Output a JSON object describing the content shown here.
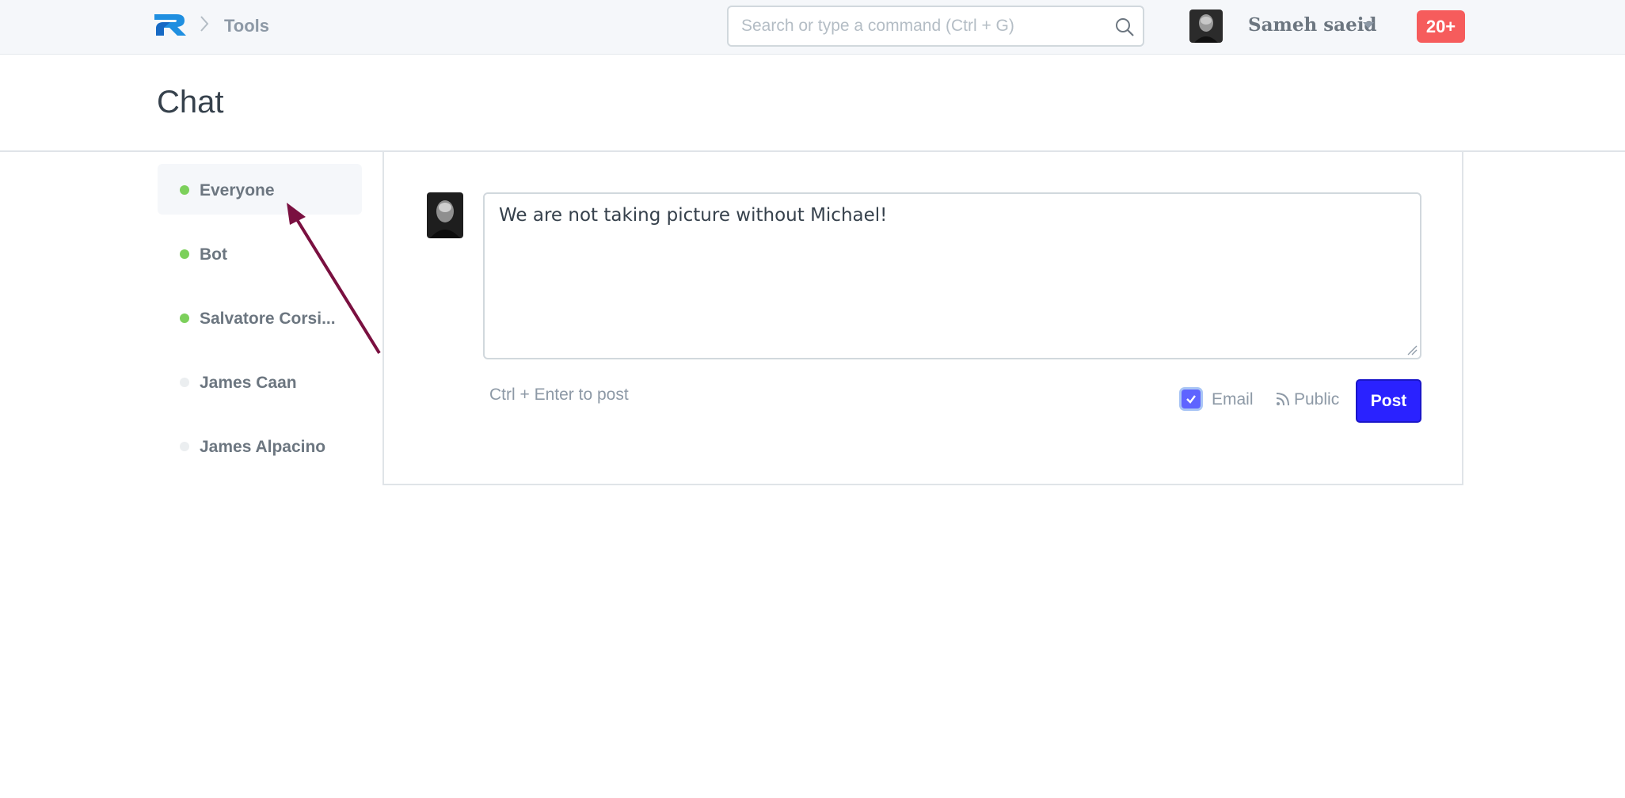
{
  "navbar": {
    "breadcrumb": "Tools",
    "search_placeholder": "Search or type a command (Ctrl + G)",
    "user_name": "Sameh saeid",
    "notifications_badge": "20+"
  },
  "page": {
    "title": "Chat"
  },
  "sidebar": {
    "items": [
      {
        "name": "Everyone",
        "status": "online",
        "active": true
      },
      {
        "name": "Bot",
        "status": "online",
        "active": false
      },
      {
        "name": "Salvatore Corsi...",
        "status": "online",
        "active": false
      },
      {
        "name": "James Caan",
        "status": "offline",
        "active": false
      },
      {
        "name": "James Alpacino",
        "status": "offline",
        "active": false
      }
    ]
  },
  "composer": {
    "message": "We are not taking picture without Michael!",
    "hint": "Ctrl + Enter to post",
    "email_label": "Email",
    "email_checked": true,
    "public_label": "Public",
    "post_label": "Post"
  },
  "colors": {
    "online": "#7cd05b",
    "offline": "#ebeef0",
    "post_button": "#2a22ff",
    "badge": "#f65c5c",
    "annotation_arrow": "#7a1040"
  }
}
